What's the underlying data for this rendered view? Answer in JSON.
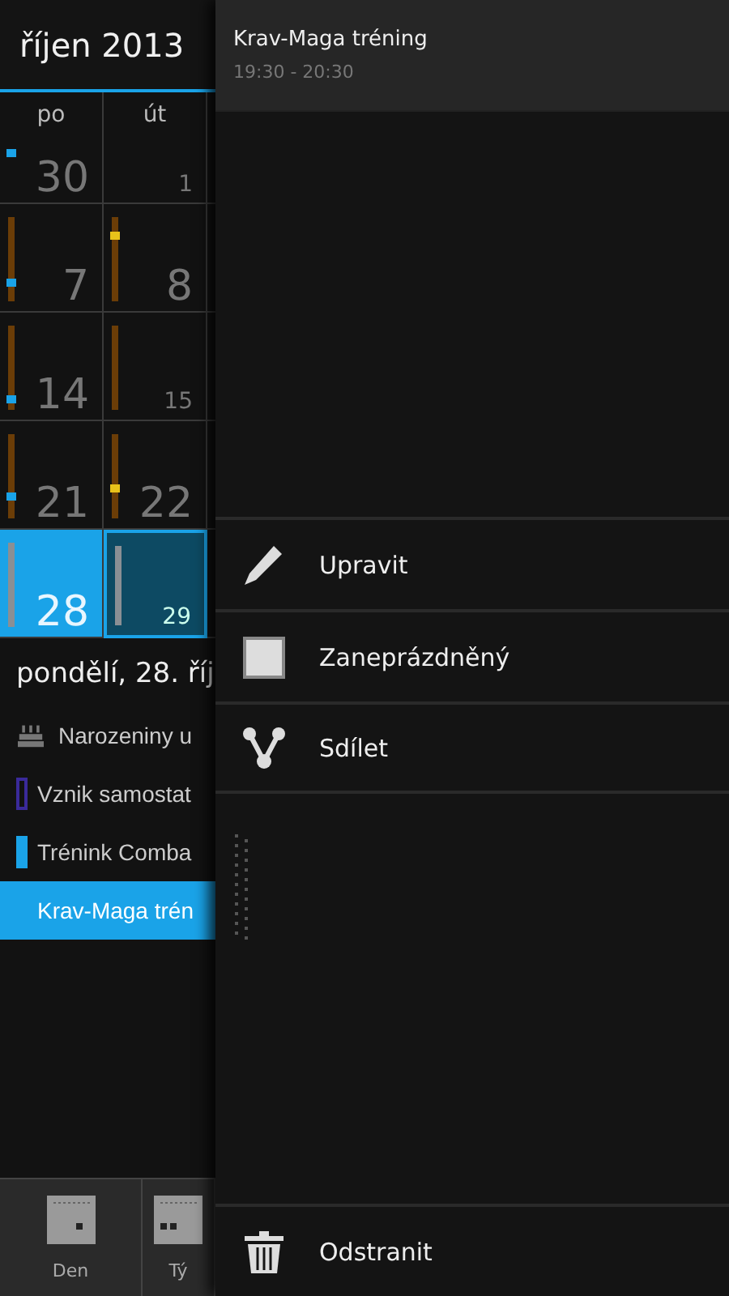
{
  "calendar": {
    "month_title": "říjen 2013",
    "weekdays": [
      "po",
      "út"
    ],
    "weeks": [
      [
        {
          "day": "30",
          "kind": "large",
          "bar": false,
          "color": "#1aa3e8",
          "level": 0.5,
          "today": false,
          "selected": false
        },
        {
          "day": "1",
          "kind": "small",
          "bar": false,
          "today": false,
          "selected": false
        }
      ],
      [
        {
          "day": "7",
          "kind": "large",
          "bar": true,
          "color": "#1aa3e8",
          "level": 0.2,
          "today": false,
          "selected": false
        },
        {
          "day": "8",
          "kind": "large",
          "bar": true,
          "color": "#e8c21a",
          "level": 0.85,
          "today": false,
          "selected": false
        }
      ],
      [
        {
          "day": "14",
          "kind": "large",
          "bar": true,
          "color": "#1aa3e8",
          "level": 0.08,
          "today": false,
          "selected": false
        },
        {
          "day": "15",
          "kind": "small",
          "bar": true,
          "today": false,
          "selected": false
        }
      ],
      [
        {
          "day": "21",
          "kind": "large",
          "bar": true,
          "color": "#1aa3e8",
          "level": 0.25,
          "today": false,
          "selected": false
        },
        {
          "day": "22",
          "kind": "large",
          "bar": true,
          "color": "#e8c21a",
          "level": 0.35,
          "today": false,
          "selected": false
        }
      ],
      [
        {
          "day": "28",
          "kind": "large",
          "bar": true,
          "today": true,
          "selected": false
        },
        {
          "day": "29",
          "kind": "small",
          "bar": true,
          "today": false,
          "selected": true
        }
      ]
    ]
  },
  "agenda": {
    "date_heading": "pondělí, 28. říj",
    "events": [
      {
        "kind": "birthday",
        "title": "Narozeniny u",
        "selected": false
      },
      {
        "kind": "outline",
        "color": "#3a2a9a",
        "title": "Vznik samostat",
        "selected": false
      },
      {
        "kind": "filled",
        "color": "#1aa3e8",
        "title": "Trénink Comba",
        "selected": false
      },
      {
        "kind": "plain",
        "title": "Krav-Maga trén",
        "selected": true
      }
    ]
  },
  "bottom_tabs": [
    {
      "label": "Den"
    },
    {
      "label": "Tý"
    }
  ],
  "context_menu": {
    "event_title": "Krav-Maga tréning",
    "event_time": "19:30 - 20:30",
    "actions": [
      {
        "label": "Upravit"
      },
      {
        "label": "Zaneprázdněný"
      },
      {
        "label": "Sdílet"
      }
    ],
    "footer_action": {
      "label": "Odstranit"
    }
  }
}
